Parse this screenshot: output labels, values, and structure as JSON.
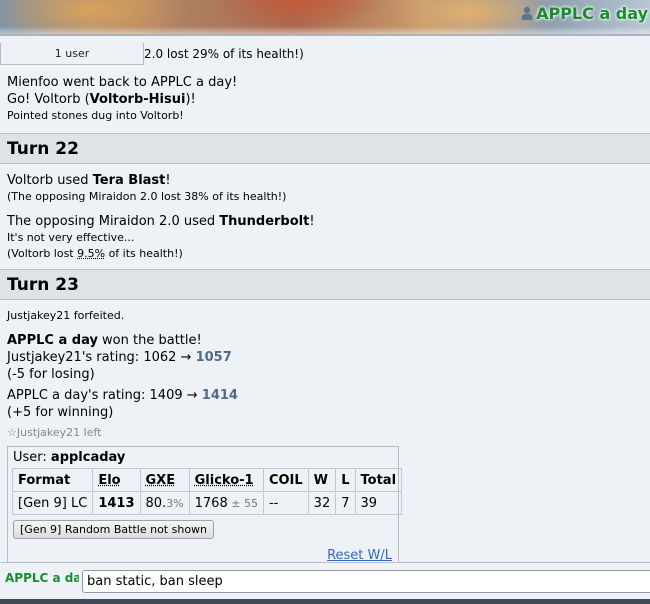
{
  "header": {
    "username": "APPLC a day"
  },
  "users_pill": {
    "label": "1 user"
  },
  "log": {
    "partial_line": "2.0 lost 29% of its health!)",
    "switch_lines": [
      {
        "type": "plain",
        "text": "Mienfoo went back to APPLC a day!"
      },
      {
        "type": "go",
        "prefix": "Go! Voltorb (",
        "bold": "Voltorb-Hisui",
        "suffix": ")!"
      },
      {
        "type": "small",
        "text": "Pointed stones dug into Voltorb!"
      }
    ],
    "turn22": {
      "title": "Turn 22",
      "move1_prefix": "Voltorb used ",
      "move1_name": "Tera Blast",
      "move1_suffix": "!",
      "move1_result": "(The opposing Miraidon 2.0 lost 38% of its health!)",
      "move2_prefix": "The opposing Miraidon 2.0 used ",
      "move2_name": "Thunderbolt",
      "move2_suffix": "!",
      "move2_effect": "It's not very effective...",
      "move2_result_prefix": "(Voltorb lost ",
      "move2_result_pct": "9.5%",
      "move2_result_suffix": " of its health!)"
    },
    "turn23": {
      "title": "Turn 23",
      "forfeit": "Justjakey21 forfeited.",
      "winner": "APPLC a day",
      "winner_suffix": " won the battle!",
      "loser_rating_prefix": "Justjakey21's rating: 1062 → ",
      "loser_rating_new": "1057",
      "loser_change": "(-5 for losing)",
      "winner_rating_prefix": "APPLC a day's rating: 1409 → ",
      "winner_rating_new": "1414",
      "winner_change": "(+5 for winning)",
      "left_message": "☆Justjakey21 left"
    }
  },
  "user_stats": {
    "user_label": "User: ",
    "user_name": "applcaday",
    "columns": [
      "Format",
      "Elo",
      "GXE",
      "Glicko-1",
      "COIL",
      "W",
      "L",
      "Total"
    ],
    "row": {
      "format": "[Gen 9] LC",
      "elo": "1413",
      "gxe_main": "80.",
      "gxe_decimal": "3%",
      "glicko": "1768",
      "glicko_dev": " ± 55",
      "coil": "--",
      "w": "32",
      "l": "7",
      "total": "39"
    },
    "hidden_button": "[Gen 9] Random Battle not shown",
    "reset_link": "Reset W/L"
  },
  "chat": {
    "name_label": "APPLC a day",
    "input_value": "ban static, ban sleep"
  }
}
